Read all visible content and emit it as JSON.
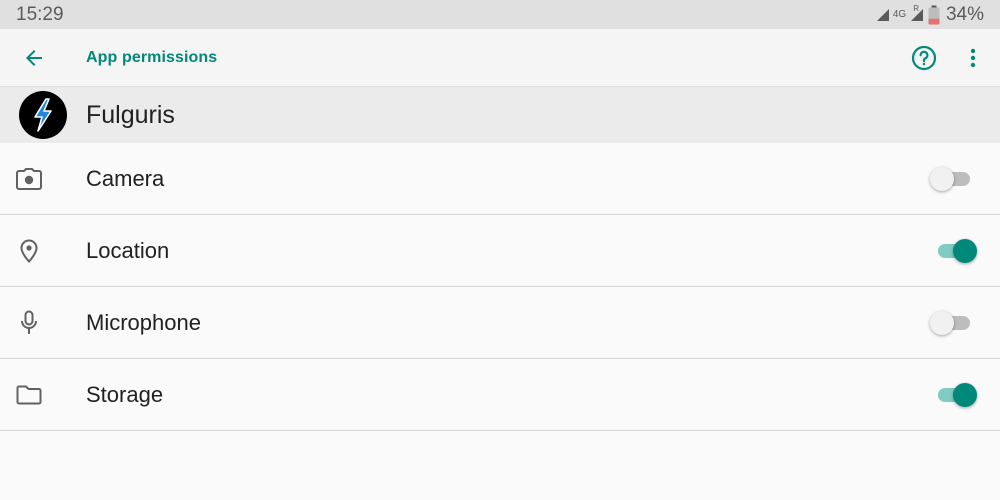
{
  "status_bar": {
    "time": "15:29",
    "network_label": "4G",
    "roaming_label": "R",
    "battery_percent": "34%",
    "battery_level": 0.34,
    "battery_color": "#e57373"
  },
  "app_bar": {
    "title": "App permissions",
    "back_icon": "arrow-back-icon",
    "help_icon": "help-circle-icon",
    "more_icon": "more-vert-icon",
    "accent_color": "#00897b"
  },
  "app": {
    "name": "Fulguris",
    "logo_icon": "lightning-bolt-logo"
  },
  "permissions": [
    {
      "label": "Camera",
      "icon": "camera-icon",
      "enabled": false
    },
    {
      "label": "Location",
      "icon": "location-pin-icon",
      "enabled": true
    },
    {
      "label": "Microphone",
      "icon": "microphone-icon",
      "enabled": false
    },
    {
      "label": "Storage",
      "icon": "folder-icon",
      "enabled": true
    }
  ]
}
